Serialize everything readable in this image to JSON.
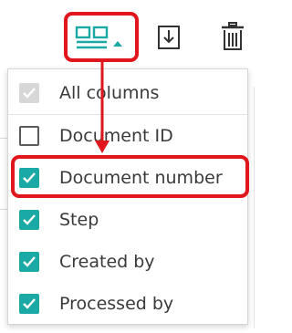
{
  "toolbar": {
    "columns_icon": "columns-icon",
    "dropdown_caret_icon": "caret-up-icon",
    "download_icon": "download-icon",
    "trash_icon": "trash-icon"
  },
  "menu": {
    "items": [
      {
        "label": "All columns",
        "state": "disabled-checked"
      },
      {
        "label": "Document ID",
        "state": "unchecked"
      },
      {
        "label": "Document number",
        "state": "checked"
      },
      {
        "label": "Step",
        "state": "checked"
      },
      {
        "label": "Created by",
        "state": "checked"
      },
      {
        "label": "Processed by",
        "state": "checked"
      }
    ]
  },
  "colors": {
    "accent_teal": "#1aa9a4",
    "annotation_red": "#e0161c",
    "disabled_grey": "#d7d7d7"
  }
}
